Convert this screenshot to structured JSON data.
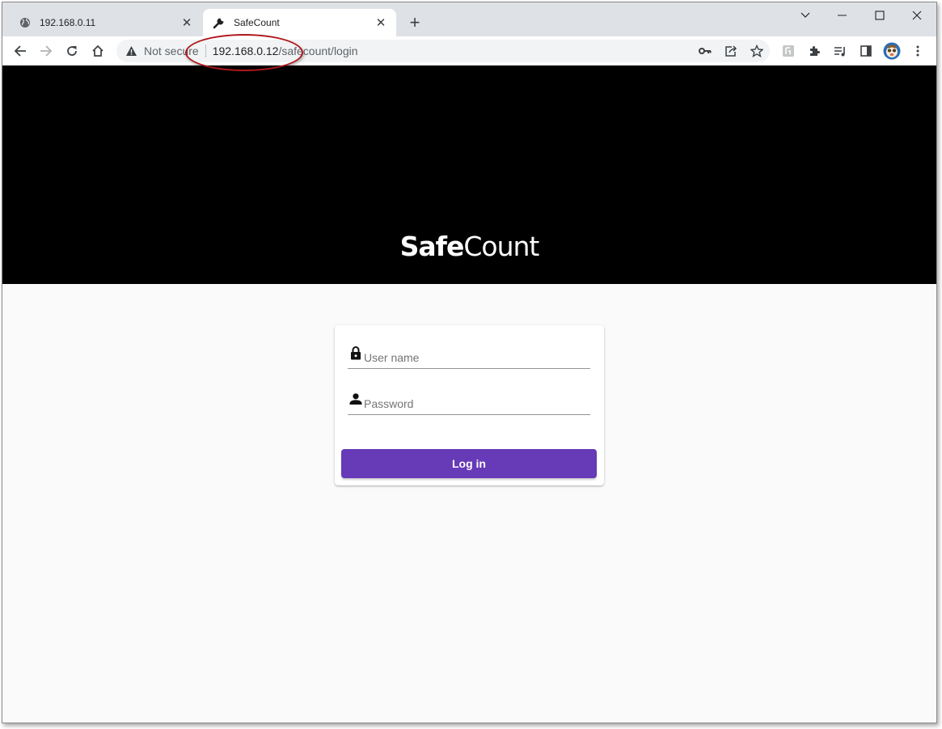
{
  "browser": {
    "tabs": [
      {
        "title": "192.168.0.11",
        "icon": "globe-icon",
        "active": false
      },
      {
        "title": "SafeCount",
        "icon": "wrench-icon",
        "active": true
      }
    ],
    "new_tab_label": "+",
    "window_controls": [
      "chevron-down-icon",
      "minimize-icon",
      "maximize-icon",
      "close-icon"
    ]
  },
  "omnibox": {
    "security_label": "Not secure",
    "url_host": "192.168.0.12",
    "url_path": "/safecount/login"
  },
  "toolbar_icons": [
    "back-icon",
    "forward-icon",
    "reload-icon",
    "home-icon",
    "key-icon",
    "share-icon",
    "star-icon",
    "extension-badge-icon",
    "puzzle-icon",
    "media-icon",
    "sidepanel-icon",
    "avatar",
    "more-icon"
  ],
  "page": {
    "logo_bold": "Safe",
    "logo_light": "Count",
    "username_placeholder": "User name",
    "password_placeholder": "Password",
    "login_label": "Log in"
  },
  "colors": {
    "hero": "#000000",
    "button": "#673ab7",
    "annotation": "#b0171b"
  }
}
